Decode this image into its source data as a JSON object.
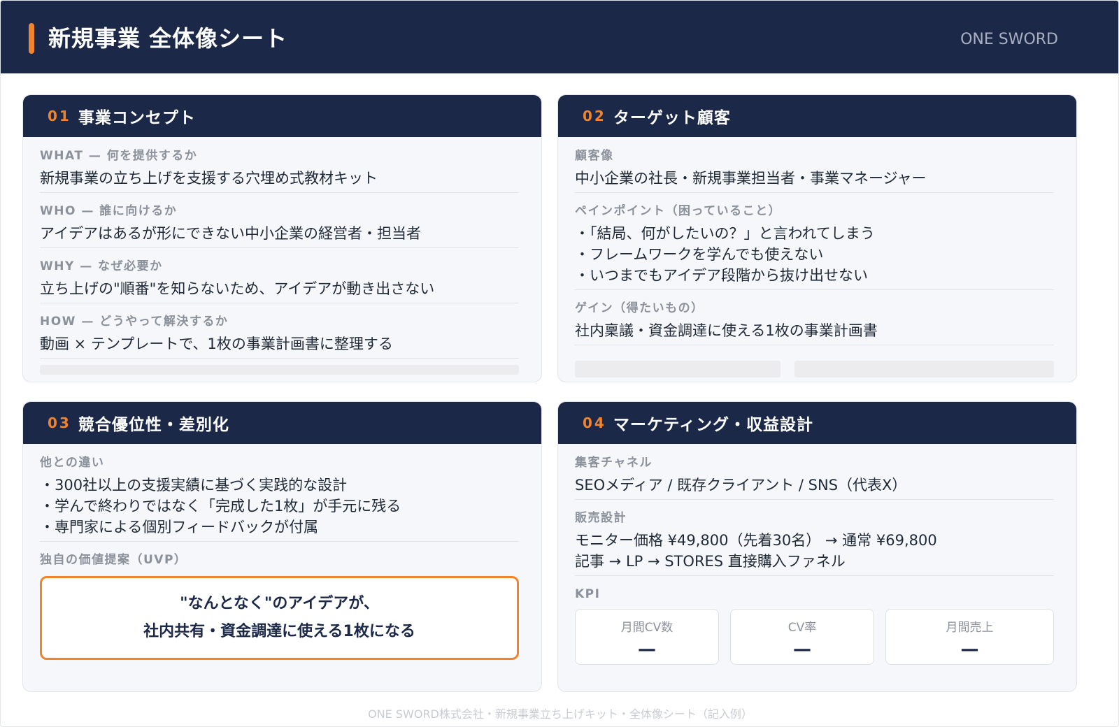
{
  "header": {
    "title": "新規事業 全体像シート",
    "brand": "ONE SWORD"
  },
  "sections": {
    "concept": {
      "num": "01",
      "title": "事業コンセプト",
      "fields": [
        {
          "label": "WHAT — 何を提供するか",
          "value": "新規事業の立ち上げを支援する穴埋め式教材キット"
        },
        {
          "label": "WHO — 誰に向けるか",
          "value": "アイデアはあるが形にできない中小企業の経営者・担当者"
        },
        {
          "label": "WHY — なぜ必要か",
          "value": "立ち上げの\"順番\"を知らないため、アイデアが動き出さない"
        },
        {
          "label": "HOW — どうやって解決するか",
          "value": "動画 × テンプレートで、1枚の事業計画書に整理する"
        }
      ]
    },
    "target": {
      "num": "02",
      "title": "ターゲット顧客",
      "persona_label": "顧客像",
      "persona_value": "中小企業の社長・新規事業担当者・事業マネージャー",
      "pain_label": "ペインポイント（困っていること）",
      "pains": [
        "・「結局、何がしたいの？」と言われてしまう",
        "・フレームワークを学んでも使えない",
        "・いつまでもアイデア段階から抜け出せない"
      ],
      "gain_label": "ゲイン（得たいもの）",
      "gain_value": "社内稟議・資金調達に使える1枚の事業計画書"
    },
    "advantage": {
      "num": "03",
      "title": "競合優位性・差別化",
      "diff_label": "他との違い",
      "diffs": [
        "・300社以上の支援実績に基づく実践的な設計",
        "・学んで終わりではなく「完成した1枚」が手元に残る",
        "・専門家による個別フィードバックが付属"
      ],
      "uvp_label": "独自の価値提案（UVP）",
      "uvp_lines": [
        "\"なんとなく\"のアイデアが、",
        "社内共有・資金調達に使える1枚になる"
      ]
    },
    "marketing": {
      "num": "04",
      "title": "マーケティング・収益設計",
      "channel_label": "集客チャネル",
      "channel_value": "SEOメディア / 既存クライアント / SNS（代表X）",
      "sales_label": "販売設計",
      "sales_lines": [
        "モニター価格 ¥49,800（先着30名） → 通常 ¥69,800",
        "記事 → LP → STORES 直接購入ファネル"
      ],
      "kpi_label": "KPI",
      "kpis": [
        {
          "label": "月間CV数",
          "value": "—"
        },
        {
          "label": "CV率",
          "value": "—"
        },
        {
          "label": "月間売上",
          "value": "—"
        }
      ]
    }
  },
  "footer": "ONE SWORD株式会社・新規事業立ち上げキット・全体像シート（記入例）",
  "colors": {
    "navy": "#1b2848",
    "accent": "#f0842c"
  }
}
